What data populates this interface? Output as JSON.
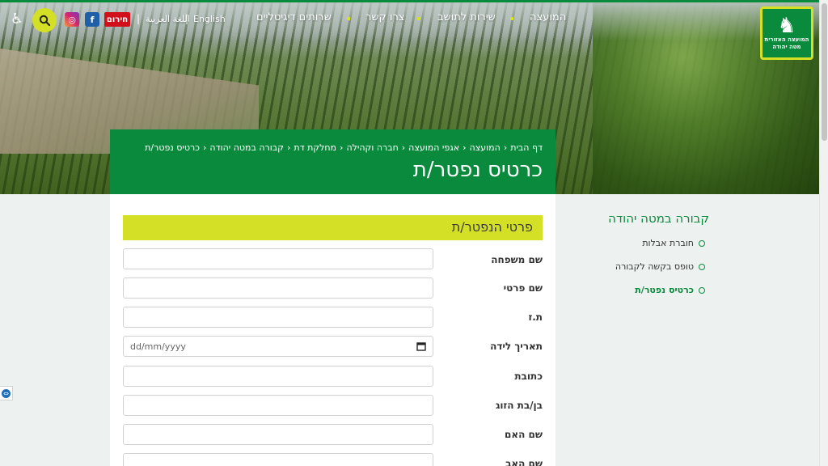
{
  "header": {
    "logo_text": "המועצה האזורית מטה יהודה",
    "nav": [
      "המועצה",
      "שירות לתושב",
      "צרו קשר",
      "שרותים דיגיטליים"
    ],
    "lang_english": "English",
    "lang_arabic": "اللغة العربية",
    "separator": "|",
    "emergency": "חירום",
    "facebook": "f",
    "instagram": "◎"
  },
  "breadcrumb": [
    "דף הבית",
    "המועצה",
    "אגפי המועצה",
    "חברה וקהילה",
    "מחלקת דת",
    "קבורה במטה יהודה",
    "כרטיס נפטר/ת"
  ],
  "breadcrumb_sep": "‹",
  "page_title": "כרטיס נפטר/ת",
  "form": {
    "section_title": "פרטי הנפטר/ת",
    "fields": [
      {
        "label": "שם משפחה",
        "value": ""
      },
      {
        "label": "שם פרטי",
        "value": ""
      },
      {
        "label": "ת.ז",
        "value": ""
      },
      {
        "label": "תאריך לידה",
        "placeholder": "dd/mm/yyyy"
      },
      {
        "label": "כתובת",
        "value": ""
      },
      {
        "label": "בן/בת הזוג",
        "value": ""
      },
      {
        "label": "שם האם",
        "value": ""
      },
      {
        "label": "שם האב",
        "value": ""
      }
    ]
  },
  "sidebar": {
    "title": "קבורה במטה יהודה",
    "items": [
      {
        "label": "חוברת אבלות",
        "active": false
      },
      {
        "label": "טופס בקשה לקבורה",
        "active": false
      },
      {
        "label": "כרטיס נפטר/ת",
        "active": true
      }
    ]
  },
  "colors": {
    "brand_green": "#0a8a3c",
    "accent_lime": "#d4e026",
    "emergency_red": "#d0111b"
  }
}
